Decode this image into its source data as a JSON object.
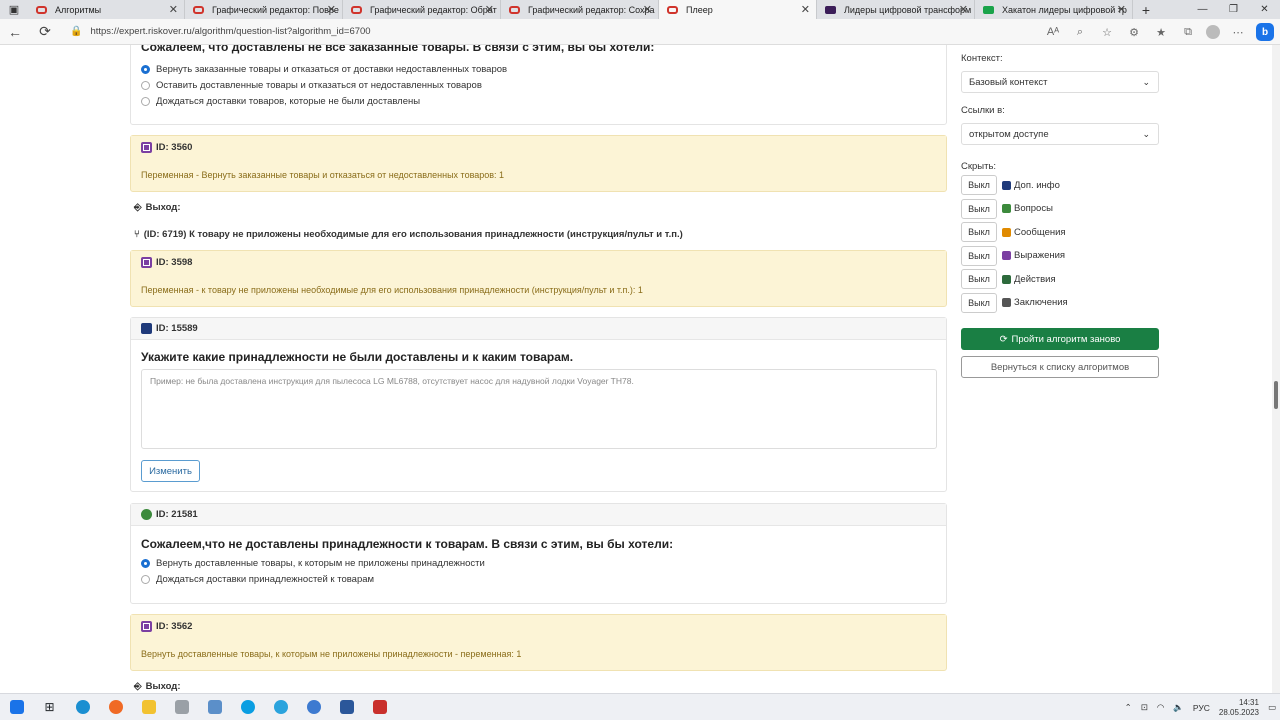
{
  "browser": {
    "tabs": [
      {
        "title": "Алгоритмы",
        "icon": "red-frame-icon",
        "width": 157
      },
      {
        "title": "Графический редактор: Повре",
        "icon": "red-frame-icon",
        "width": 158
      },
      {
        "title": "Графический редактор: Обрат",
        "icon": "red-frame-icon",
        "width": 158
      },
      {
        "title": "Графический редактор: Сохра",
        "icon": "red-frame-icon",
        "width": 158
      },
      {
        "title": "Плеер",
        "icon": "red-frame-icon",
        "width": 158,
        "active": true
      },
      {
        "title": "Лидеры цифровой трансформ",
        "icon": "purple-square-icon",
        "width": 158
      },
      {
        "title": "Хакатон лидеры цифровой тр",
        "icon": "green-plus-icon",
        "width": 158
      }
    ],
    "url": "https://expert.riskover.ru/algorithm/question-list?algorithm_id=6700"
  },
  "main": {
    "top_question_partial": "Сожалеем, что доставлены не все заказанные товары. В связи с этим, вы бы хотели:",
    "top_options": [
      {
        "label": "Вернуть заказанные товары и отказаться от доставки недоставленных товаров",
        "checked": true
      },
      {
        "label": "Оставить доставленные товары и отказаться от недоставленных товаров",
        "checked": false
      },
      {
        "label": "Дождаться доставки товаров, которые не были доставлены",
        "checked": false
      }
    ],
    "expr1": {
      "id": "ID: 3560",
      "text": "Переменная - Вернуть заказанные товары и отказаться от недоставленных товаров: 1"
    },
    "exit1_label": "Выход:",
    "link1": "(ID: 6719) К товару не приложены необходимые для его использования принадлежности (инструкция/пульт и т.п.)",
    "expr2": {
      "id": "ID: 3598",
      "text": "Переменная - к товару не приложены необходимые для его использования принадлежности (инструкция/пульт и т.п.): 1"
    },
    "info": {
      "id": "ID: 15589",
      "question": "Укажите какие принадлежности не были доставлены и к каким товарам.",
      "placeholder": "Пример: не была доставлена инструкция для пылесоса LG ML6788, отсутствует насос для надувной лодки Voyager TH78.",
      "edit_label": "Изменить"
    },
    "q2": {
      "id": "ID: 21581",
      "question": "Сожалеем,что не доставлены принадлежности к товарам. В связи с этим, вы бы хотели:",
      "options": [
        {
          "label": "Вернуть доставленные товары, к которым не приложены принадлежности",
          "checked": true
        },
        {
          "label": "Дождаться доставки принадлежностей к товарам",
          "checked": false
        }
      ]
    },
    "expr3": {
      "id": "ID: 3562",
      "text": "Вернуть доставленные товары, к которым не приложены принадлежности - переменная: 1"
    },
    "exit2_label": "Выход:"
  },
  "sidebar": {
    "context_label": "Контекст:",
    "context_value": "Базовый контекст",
    "links_label": "Ссылки в:",
    "links_value": "открытом доступе",
    "hide_label": "Скрыть:",
    "hide_items": [
      {
        "button": "Выкл",
        "label": "Доп. инфо",
        "color": "#1f3a7a"
      },
      {
        "button": "Выкл",
        "label": "Вопросы",
        "color": "#3c8a3c"
      },
      {
        "button": "Выкл",
        "label": "Сообщения",
        "color": "#e08a00"
      },
      {
        "button": "Выкл",
        "label": "Выражения",
        "color": "#7b3fa2"
      },
      {
        "button": "Выкл",
        "label": "Действия",
        "color": "#2d6a3c"
      },
      {
        "button": "Выкл",
        "label": "Заключения",
        "color": "#555555"
      }
    ],
    "restart_label": "Пройти алгоритм заново",
    "back_label": "Вернуться к списку алгоритмов"
  },
  "taskbar": {
    "lang": "РУС",
    "time": "14:31",
    "date": "28.05.2023"
  }
}
